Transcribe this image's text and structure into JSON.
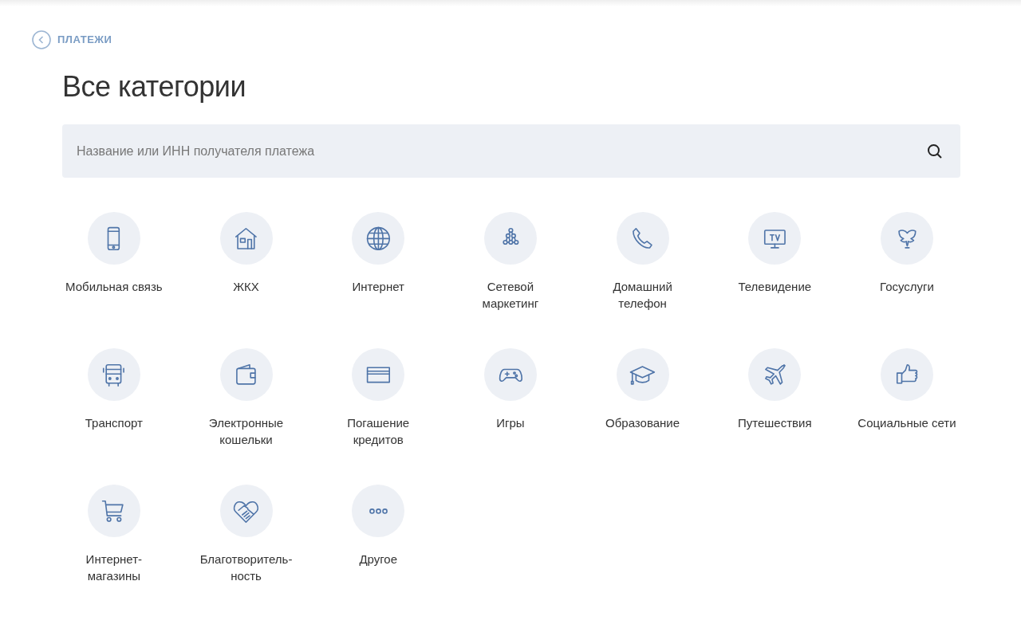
{
  "back_link": {
    "label": "ПЛАТЕЖИ"
  },
  "title": "Все категории",
  "search": {
    "placeholder": "Название или ИНН получателя платежа"
  },
  "categories": [
    {
      "label": "Мобильная связь"
    },
    {
      "label": "ЖКХ"
    },
    {
      "label": "Интернет"
    },
    {
      "label": "Сетевой\nмаркетинг"
    },
    {
      "label": "Домашний\nтелефон"
    },
    {
      "label": "Телевидение"
    },
    {
      "label": "Госуслуги"
    },
    {
      "label": "Транспорт"
    },
    {
      "label": "Электронные\nкошельки"
    },
    {
      "label": "Погашение\nкредитов"
    },
    {
      "label": "Игры"
    },
    {
      "label": "Образование"
    },
    {
      "label": "Путешествия"
    },
    {
      "label": "Социальные сети"
    },
    {
      "label": "Интернет-\nмагазины"
    },
    {
      "label": "Благотворитель-\nность"
    },
    {
      "label": "Другое"
    }
  ]
}
